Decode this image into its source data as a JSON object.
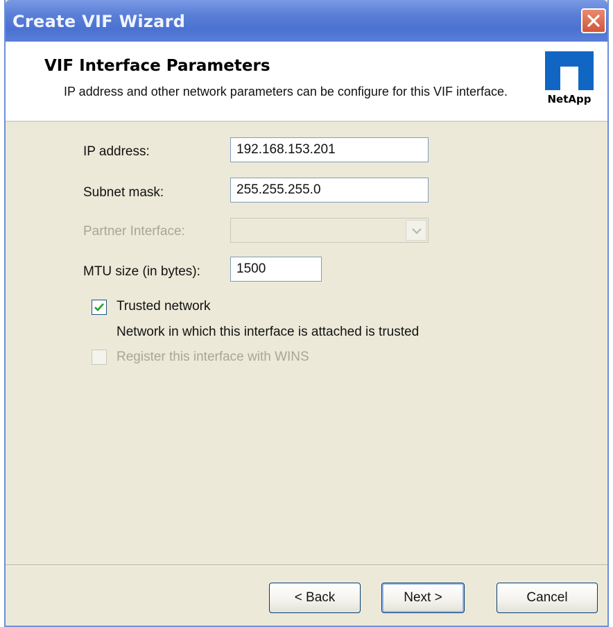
{
  "window": {
    "title": "Create VIF Wizard"
  },
  "header": {
    "title": "VIF Interface Parameters",
    "subtitle": "IP address and other network parameters can be configure for this VIF interface.",
    "logo_text": "NetApp",
    "logo_color": "#1166c4"
  },
  "form": {
    "ip_label": "IP address:",
    "ip_value": "192.168.153.201",
    "subnet_label": "Subnet mask:",
    "subnet_value": "255.255.255.0",
    "partner_label": "Partner Interface:",
    "partner_value": "",
    "mtu_label": "MTU size (in bytes):",
    "mtu_value": "1500",
    "trusted_label": "Trusted network",
    "trusted_checked": true,
    "trusted_desc": "Network in which this interface is attached is trusted",
    "wins_label": "Register this interface with WINS",
    "wins_checked": false
  },
  "buttons": {
    "back": "< Back",
    "next": "Next >",
    "cancel": "Cancel"
  },
  "icons": {
    "close": "close-icon",
    "dropdown": "chevron-down-icon",
    "check": "check-icon",
    "logo": "netapp-logo-icon"
  }
}
